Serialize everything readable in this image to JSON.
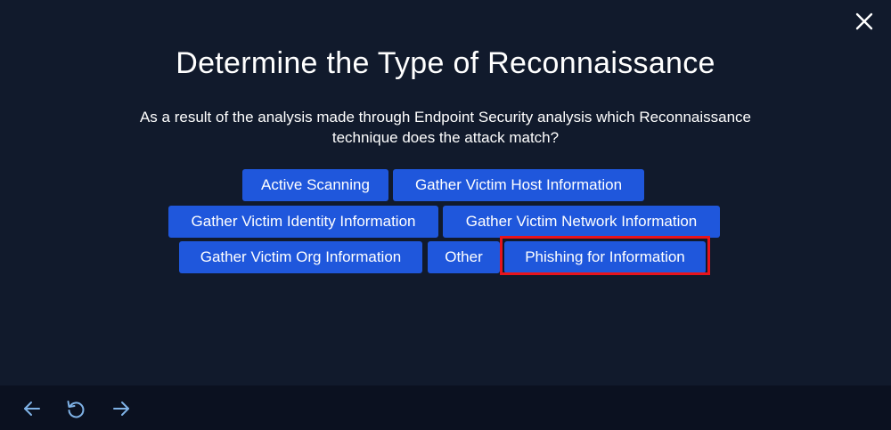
{
  "dialog": {
    "title": "Determine the Type of Reconnaissance",
    "question": "As a result of the analysis made through Endpoint Security analysis which Reconnaissance technique does the attack match?"
  },
  "options": [
    {
      "label": "Active Scanning"
    },
    {
      "label": "Gather Victim Host Information"
    },
    {
      "label": "Gather Victim Identity Information"
    },
    {
      "label": "Gather Victim Network Information"
    },
    {
      "label": "Gather Victim Org Information"
    },
    {
      "label": "Other"
    },
    {
      "label": "Phishing for Information",
      "highlighted": true
    }
  ],
  "icons": {
    "close": "close-icon",
    "back": "arrow-left-icon",
    "reset": "refresh-icon",
    "forward": "arrow-right-icon"
  },
  "colors": {
    "background": "#111a2c",
    "footer": "#0b1120",
    "button": "#1f57dc",
    "highlight": "#e8141c",
    "footer_icon": "#7fb2e6"
  }
}
